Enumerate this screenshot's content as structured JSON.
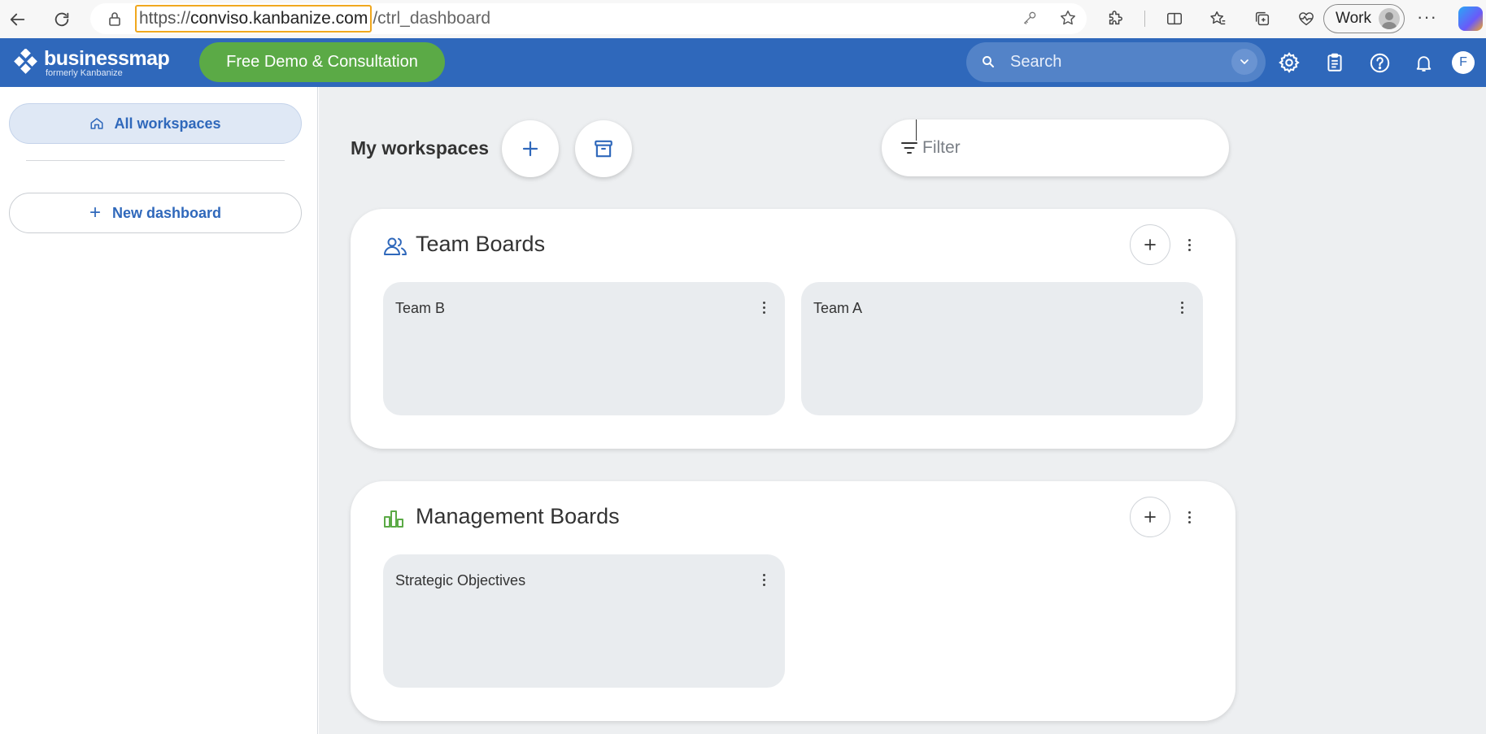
{
  "browser": {
    "url_scheme": "https://",
    "url_host": "conviso.kanbanize.com",
    "url_path": "/ctrl_dashboard",
    "profile_label": "Work",
    "more_label": "···"
  },
  "header": {
    "logo_name": "businessmap",
    "logo_sub": "formerly Kanbanize",
    "demo_button": "Free Demo & Consultation",
    "search_placeholder": "Search",
    "user_initial": "F",
    "brand_color": "#2f68bb",
    "demo_color": "#5baa46"
  },
  "sidebar": {
    "all_workspaces": "All workspaces",
    "new_dashboard": "New dashboard",
    "new_dashboard_plus": "+"
  },
  "main": {
    "title": "My workspaces",
    "filter_placeholder": "Filter",
    "workspaces": [
      {
        "name": "Team Boards",
        "icon": "people-icon",
        "boards": [
          "Team B",
          "Team A"
        ]
      },
      {
        "name": "Management Boards",
        "icon": "bar-chart-icon",
        "boards": [
          "Strategic Objectives"
        ]
      }
    ]
  }
}
